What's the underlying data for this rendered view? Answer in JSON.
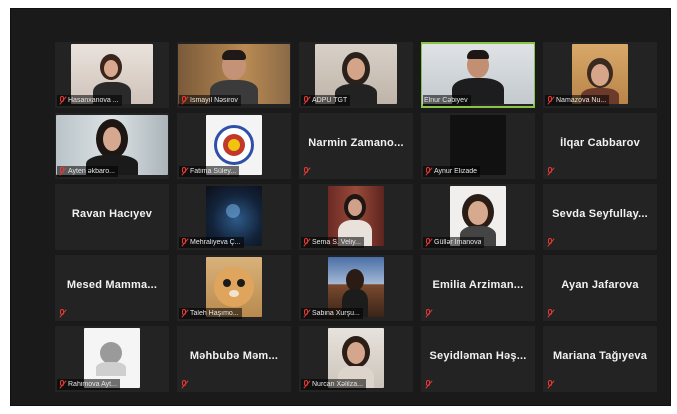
{
  "participants": [
    {
      "name": "Hasanxanova ..."
    },
    {
      "name": "İsmayıl Nəsirov"
    },
    {
      "name": "ADPU TGT"
    },
    {
      "name": "Elnur Cəbiyev"
    },
    {
      "name": "Namazova Nu..."
    },
    {
      "name": "Ayten əkbarо..."
    },
    {
      "name": "Fatima Süley..."
    },
    {
      "name": "Narmin Zamano..."
    },
    {
      "name": "Aynur Elizade"
    },
    {
      "name": "İlqar Cabbarov"
    },
    {
      "name": "Ravan Hacıyev"
    },
    {
      "name": "Mehraliyeva Ç..."
    },
    {
      "name": "Sema S. Veliy..."
    },
    {
      "name": "Güllər İmanova"
    },
    {
      "name": "Sevda Seyfullay..."
    },
    {
      "name": "Mesed Mamma..."
    },
    {
      "name": "Taleh Haşımo..."
    },
    {
      "name": "Sabina Xurşu..."
    },
    {
      "name": "Emilia Arziman..."
    },
    {
      "name": "Ayan Jafarova"
    },
    {
      "name": "Rahimova Ayt..."
    },
    {
      "name": "Məhbubə Məm..."
    },
    {
      "name": "Nurcan Xəlilza..."
    },
    {
      "name": "Seyidləman Həş..."
    },
    {
      "name": "Mariana Tağıyeva"
    }
  ],
  "colors": {
    "muted_mic": "#e53935",
    "active_speaker_border": "#8bc34a"
  }
}
